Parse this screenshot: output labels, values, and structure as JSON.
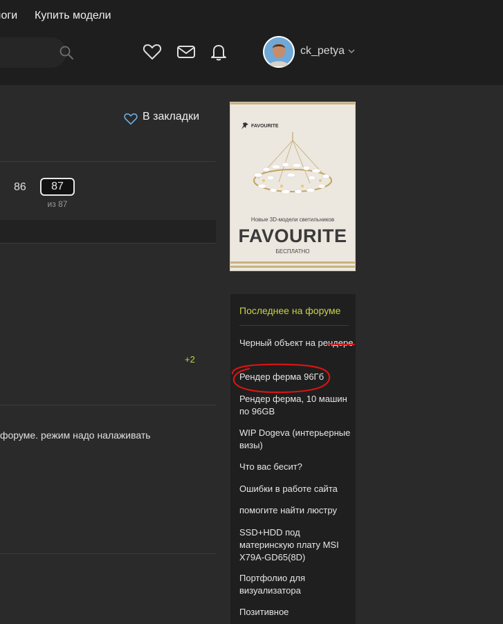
{
  "nav": {
    "items": [
      "логи",
      "Купить модели"
    ]
  },
  "header": {
    "username": "ck_petya"
  },
  "main": {
    "bookmark_label": "В закладки",
    "pagination": {
      "prev_page": "86",
      "current_page": "87",
      "total": "из 87"
    },
    "vote_badge": "+2",
    "post_snippet": "форуме. режим надо налаживать"
  },
  "banner": {
    "brand_small": "FAVOURITE",
    "subtitle": "Новые 3D-модели светильников",
    "title": "FAVOURITE",
    "free": "БЕСПЛАТНО"
  },
  "forum": {
    "title": "Последнее на форуме",
    "links": [
      "Черный объект на рендере",
      "Рендер ферма 96Гб",
      "Рендер ферма, 10 машин по 96GB",
      "WIP Dogeva (интерьерные визы)",
      "Что вас бесит?",
      "Ошибки в работе сайта",
      "помогите найти люстру",
      "SSD+HDD под материнскую плату MSI X79A-GD65(8D)",
      "Портфолио для визуализатора",
      "Позитивное"
    ]
  },
  "colors": {
    "accent": "#c6d34a",
    "annotation": "#d81414",
    "background": "#2a2a2a",
    "topbar": "#1e1e1e"
  }
}
